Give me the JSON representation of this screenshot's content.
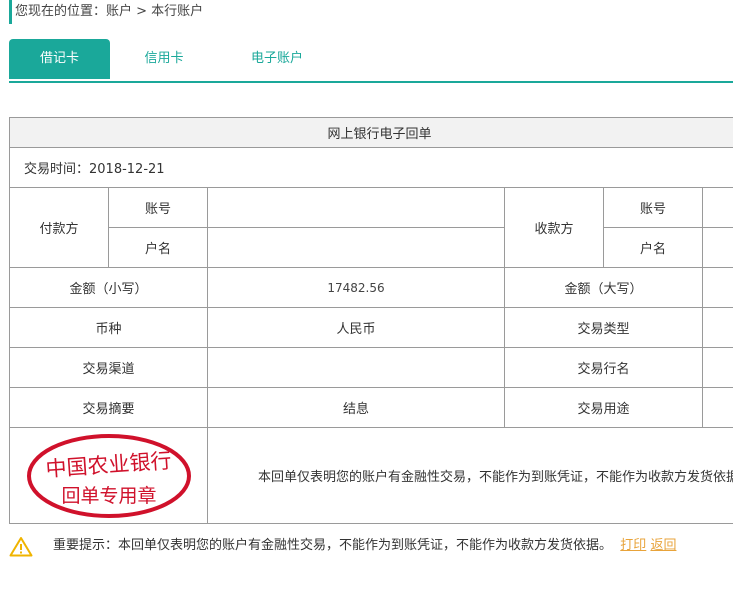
{
  "breadcrumb": {
    "text": "您现在的位置：账户 > 本行账户"
  },
  "tabs": [
    {
      "label": "借记卡",
      "active": true
    },
    {
      "label": "信用卡",
      "active": false
    },
    {
      "label": "电子账户",
      "active": false
    }
  ],
  "receipt": {
    "title": "网上银行电子回单",
    "date_label": "交易时间：2018-12-21",
    "payer_label": "付款方",
    "payee_label": "收款方",
    "account_no_label": "账号",
    "account_name_label": "户名",
    "payer_account_no": "",
    "payer_account_name": "",
    "payee_account_no": "",
    "payee_account_name": "",
    "amount_small_label": "金额（小写）",
    "amount_small": "17482.56",
    "amount_big_label": "金额（大写）",
    "amount_big": "",
    "currency_label": "币种",
    "currency": "人民币",
    "txn_type_label": "交易类型",
    "txn_type": "",
    "channel_label": "交易渠道",
    "channel": "",
    "bank_name_label": "交易行名",
    "bank_name": "",
    "summary_label": "交易摘要",
    "summary": "结息",
    "purpose_label": "交易用途",
    "purpose": "",
    "notice": "本回单仅表明您的账户有金融性交易，不能作为到账凭证，不能作为收款方发货依据。",
    "stamp": {
      "line1": "中国农业银行",
      "line2": "回单专用章",
      "color": "#d0112b"
    }
  },
  "footer": {
    "tip": "重要提示：本回单仅表明您的账户有金融性交易，不能作为到账凭证，不能作为收款方发货依据。",
    "print_label": "打印",
    "back_label": "返回"
  },
  "colors": {
    "accent": "#1aa89a",
    "link": "#e8a33a",
    "warning": "#f0b400"
  }
}
